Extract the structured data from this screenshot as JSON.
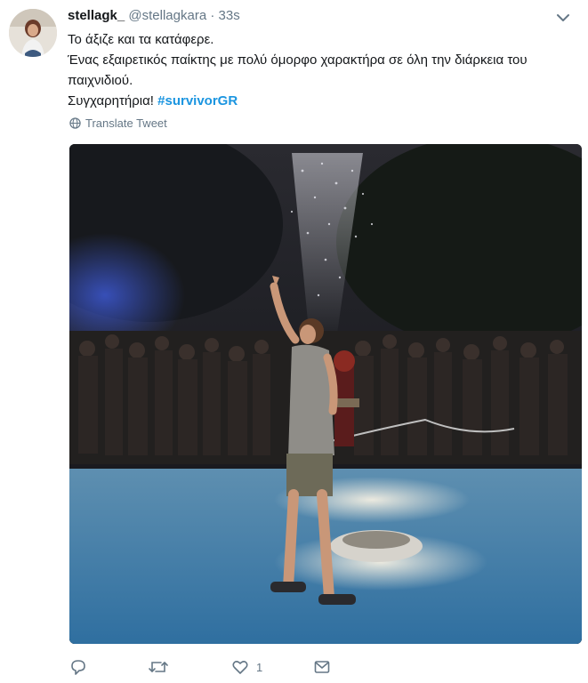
{
  "tweet": {
    "display_name": "stellagk_",
    "handle": "@stellagkara",
    "separator": "·",
    "time": "33s",
    "lines": [
      "Το άξιζε και τα κατάφερε.",
      "Ένας εξαιρετικός παίκτης με πολύ όμορφο χαρακτήρα σε όλη την διάρκεια του παιχνιδιού.",
      "Συγχαρητήρια!"
    ],
    "hashtag": "#survivorGR",
    "translate_label": "Translate Tweet"
  },
  "actions": {
    "reply_count": "",
    "retweet_count": "",
    "like_count": "1"
  },
  "colors": {
    "accent": "#1b95e0",
    "muted": "#657786",
    "text": "#14171a"
  },
  "icons": [
    "chevron-down-icon",
    "globe-icon",
    "reply-icon",
    "retweet-icon",
    "heart-icon",
    "message-icon"
  ]
}
